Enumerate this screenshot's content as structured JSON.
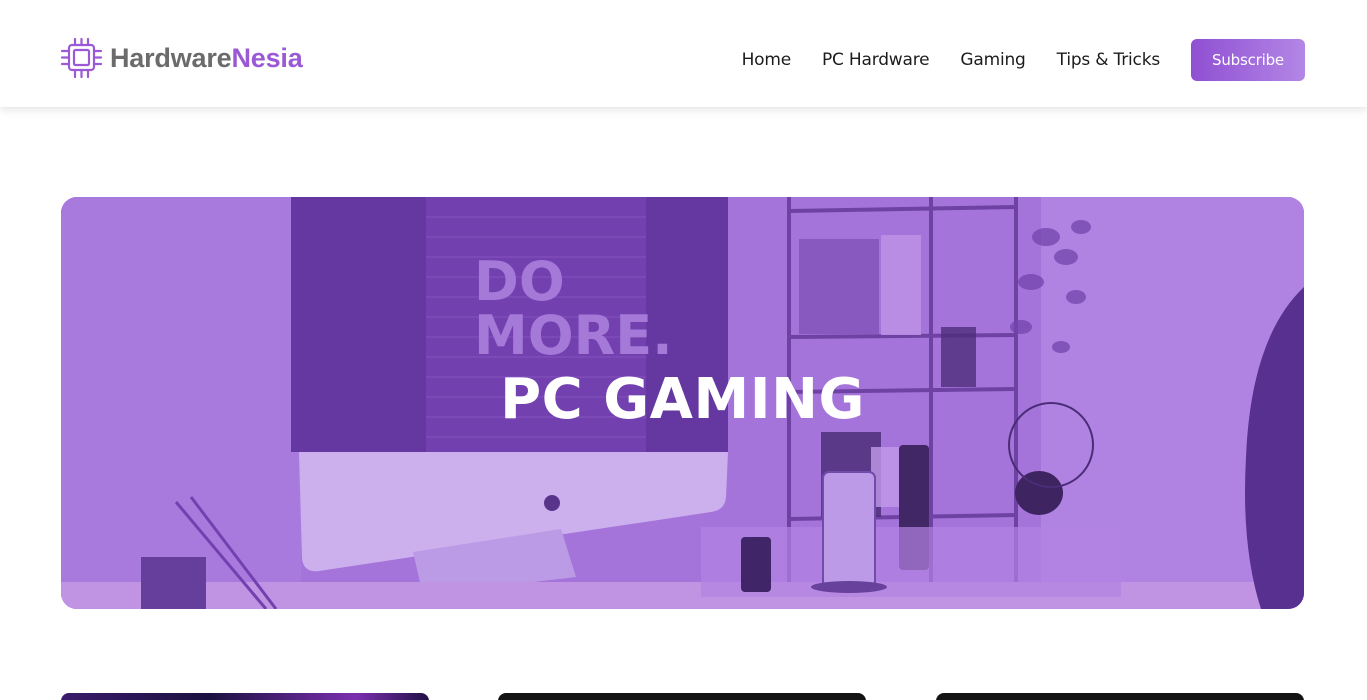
{
  "header": {
    "logo": {
      "part1": "Hardware",
      "part2": "Nesia",
      "icon": "chip-icon"
    },
    "nav": [
      {
        "label": "Home"
      },
      {
        "label": "PC Hardware"
      },
      {
        "label": "Gaming"
      },
      {
        "label": "Tips & Tricks"
      }
    ],
    "subscribe_label": "Subscribe"
  },
  "hero": {
    "title": "PC GAMING",
    "poster_line1": "DO",
    "poster_line2": "MORE."
  },
  "colors": {
    "accent": "#9b59d6",
    "hero_overlay": "#a270d8",
    "logo_gray": "#6b6b6b"
  }
}
